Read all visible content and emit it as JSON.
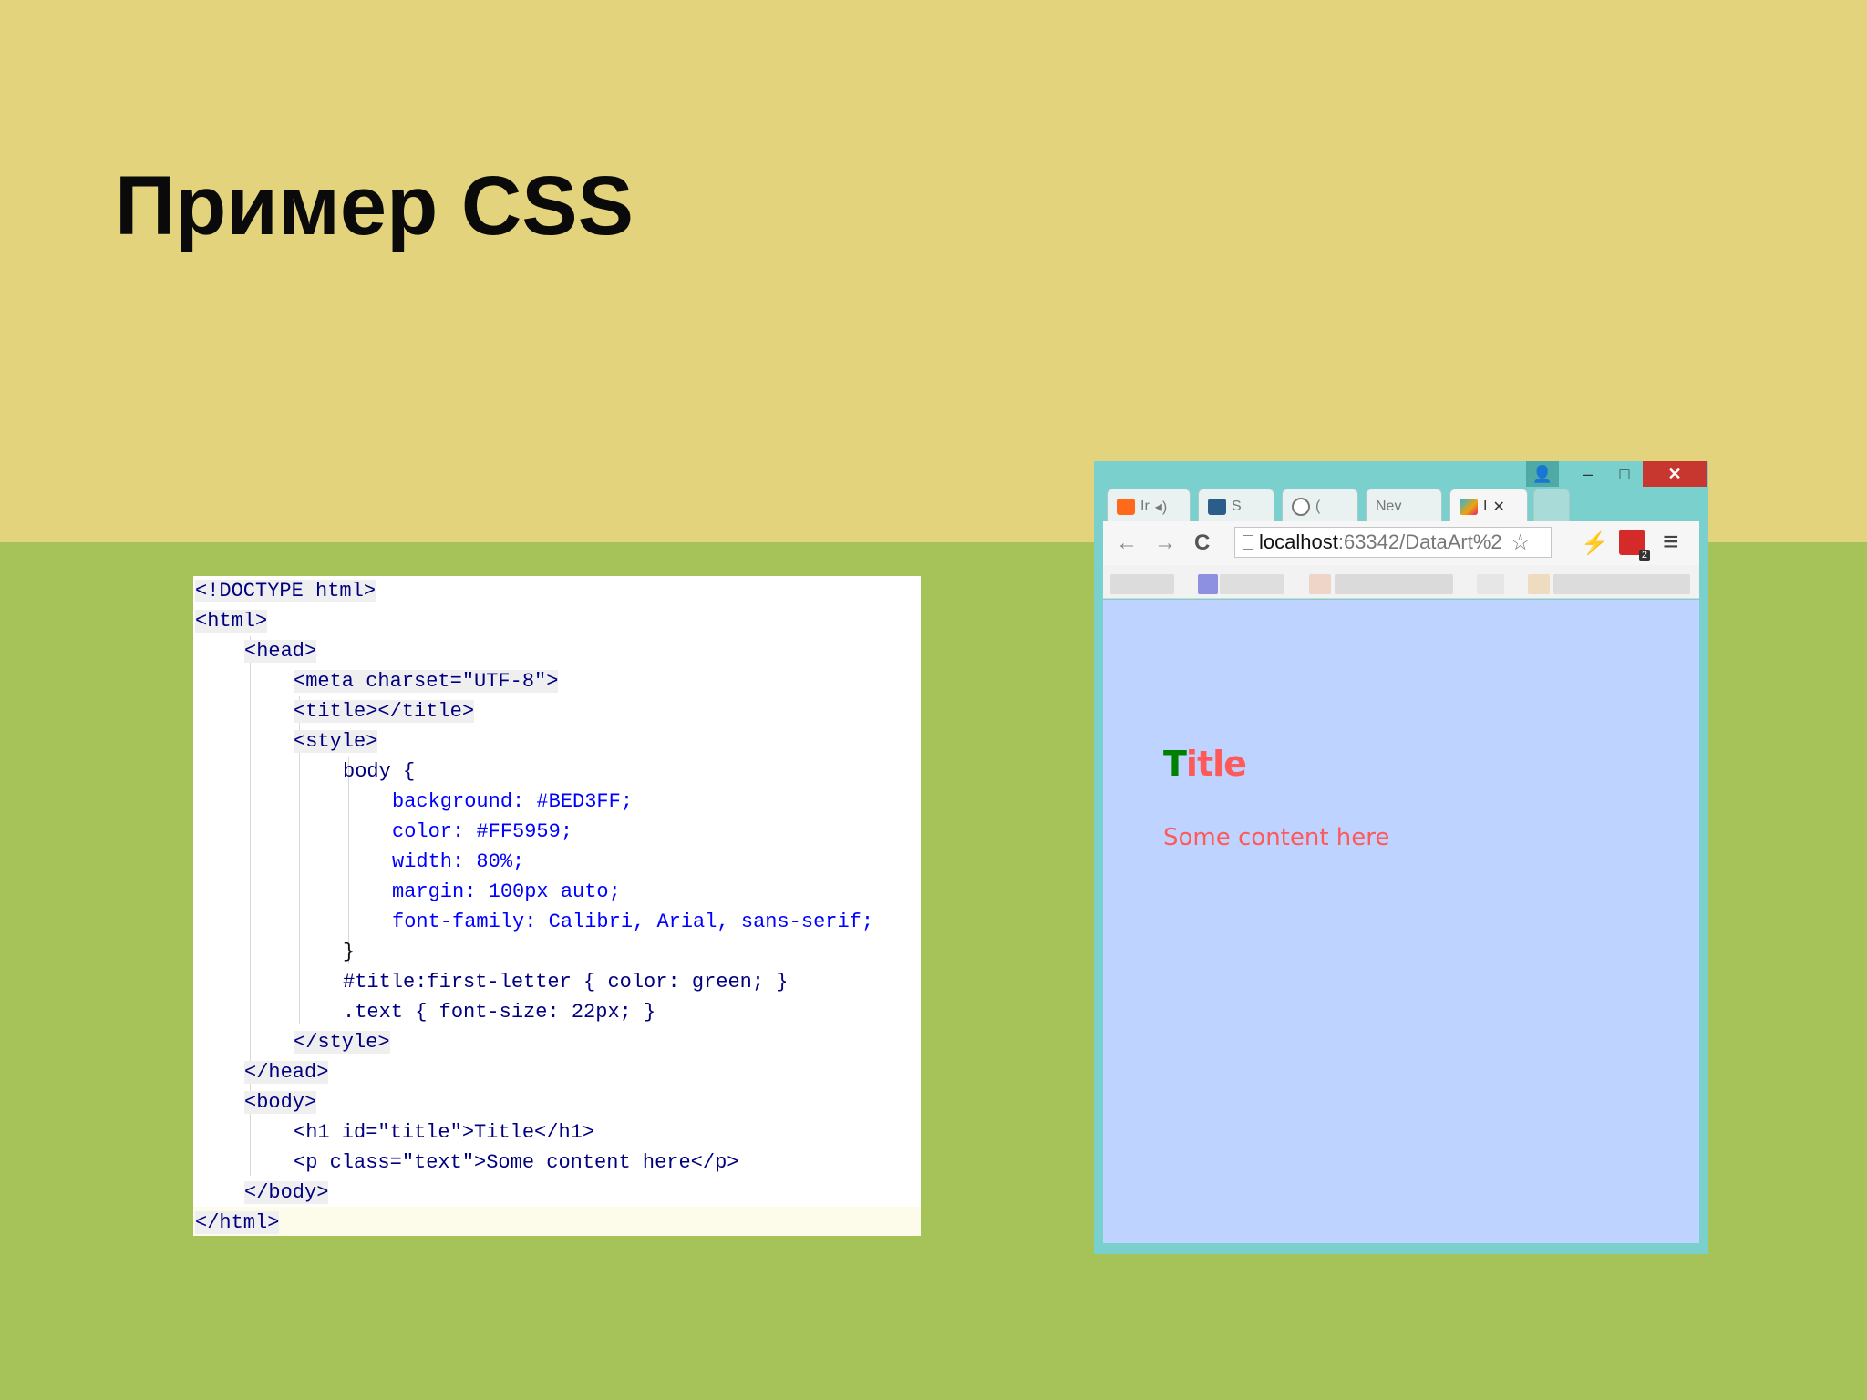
{
  "slide": {
    "title": "Пример CSS"
  },
  "code": {
    "lines": [
      "<!DOCTYPE html>",
      "<html>",
      "<head>",
      "<meta charset=\"UTF-8\">",
      "<title></title>",
      "<style>",
      "body {",
      "background: #BED3FF;",
      "color: #FF5959;",
      "width: 80%;",
      "margin: 100px auto;",
      "font-family: Calibri, Arial, sans-serif;",
      "}",
      "#title:first-letter { color: green; }",
      ".text { font-size: 22px; }",
      "</style>",
      "</head>",
      "<body>",
      "<h1 id=\"title\">Title</h1>",
      "<p class=\"text\">Some content here</p>",
      "</body>",
      "</html>"
    ]
  },
  "browser": {
    "window_controls": {
      "user": "👤",
      "minimize": "–",
      "maximize": "□",
      "close": "✕"
    },
    "tabs": [
      {
        "label": "Ir",
        "icon": "soundcloud-icon"
      },
      {
        "label": "S",
        "icon": "jenkins-icon"
      },
      {
        "label": "(",
        "icon": "chrome-store-icon"
      },
      {
        "label": "Nev",
        "icon": ""
      },
      {
        "label": "I",
        "icon": "webstorm-icon",
        "active": true
      }
    ],
    "tab_close": "✕",
    "nav": {
      "back": "←",
      "forward": "→",
      "reload": "C"
    },
    "address": {
      "host": "localhost",
      "path": ":63342/DataArt%2"
    },
    "toolbar_icons": {
      "bookmark_star": "☆",
      "lightning": "⚡",
      "extension_badge": "2",
      "menu": "≡"
    },
    "page": {
      "h1": "Title",
      "h1_first_letter": "T",
      "h1_rest": "itle",
      "paragraph": "Some content here",
      "background": "#BED3FF",
      "text_color": "#FF5959",
      "first_letter_color": "green"
    }
  }
}
